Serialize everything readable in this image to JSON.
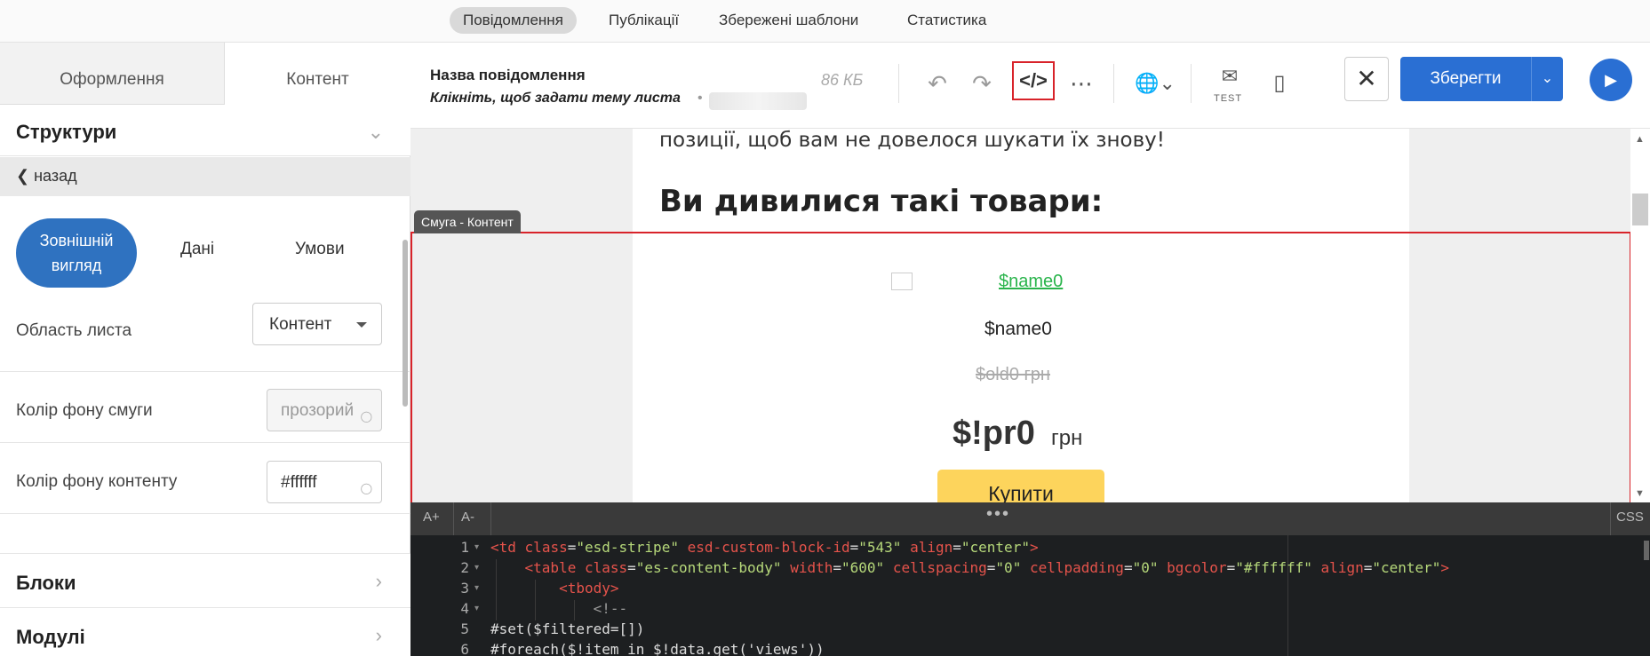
{
  "top_nav": {
    "items": [
      "Повідомлення",
      "Публікації",
      "Збережені шаблони",
      "Статистика"
    ],
    "active": 0
  },
  "left_panel": {
    "tabs": [
      "Оформлення",
      "Контент"
    ],
    "structures": "Структури",
    "back": "назад",
    "subtabs": {
      "appearance_line1": "Зовнішній",
      "appearance_line2": "вигляд",
      "data": "Дані",
      "conditions": "Умови"
    },
    "letter_area": {
      "label": "Область листа",
      "value": "Контент"
    },
    "stripe_bg": {
      "label": "Колір фону смуги",
      "value": "прозорий"
    },
    "content_bg": {
      "label": "Колір фону контенту",
      "value": "#ffffff"
    },
    "blocks": "Блоки",
    "modules": "Модулі"
  },
  "toolbar": {
    "message_name": "Назва повідомлення",
    "subject_prompt": "Клікніть, щоб задати тему листа",
    "size": "86 КБ",
    "test_label": "TEST",
    "save": "Зберегти"
  },
  "canvas": {
    "paragraph_tail": "позиції, щоб вам не довелося шукати їх знову!",
    "heading": "Ви дивилися такі товари:",
    "stripe_tag": "Смуга - Контент",
    "image_link": "$name0",
    "product_name": "$name0",
    "old_price": "$old0 грн",
    "price": "$!pr0",
    "currency": "грн",
    "buy": "Купити"
  },
  "code_bar": {
    "font_up": "A+",
    "font_down": "A-",
    "css": "CSS"
  },
  "code": {
    "line_numbers": [
      "1",
      "2",
      "3",
      "4",
      "5",
      "6"
    ],
    "line1": {
      "tag_open": "<td",
      "a1": "class",
      "v1": "\"esd-stripe\"",
      "a2": "esd-custom-block-id",
      "v2": "\"543\"",
      "a3": "align",
      "v3": "\"center\"",
      "close": ">"
    },
    "line2": {
      "tag_open": "<table",
      "a1": "class",
      "v1": "\"es-content-body\"",
      "a2": "width",
      "v2": "\"600\"",
      "a3": "cellspacing",
      "v3": "\"0\"",
      "a4": "cellpadding",
      "v4": "\"0\"",
      "a5": "bgcolor",
      "v5": "\"#ffffff\"",
      "a6": "align",
      "v6": "\"center\"",
      "close": ">"
    },
    "line3": "<tbody>",
    "line4": "<!--",
    "line5": "#set($filtered=[])",
    "line6": "#foreach($!item in $!data.get('views'))"
  }
}
